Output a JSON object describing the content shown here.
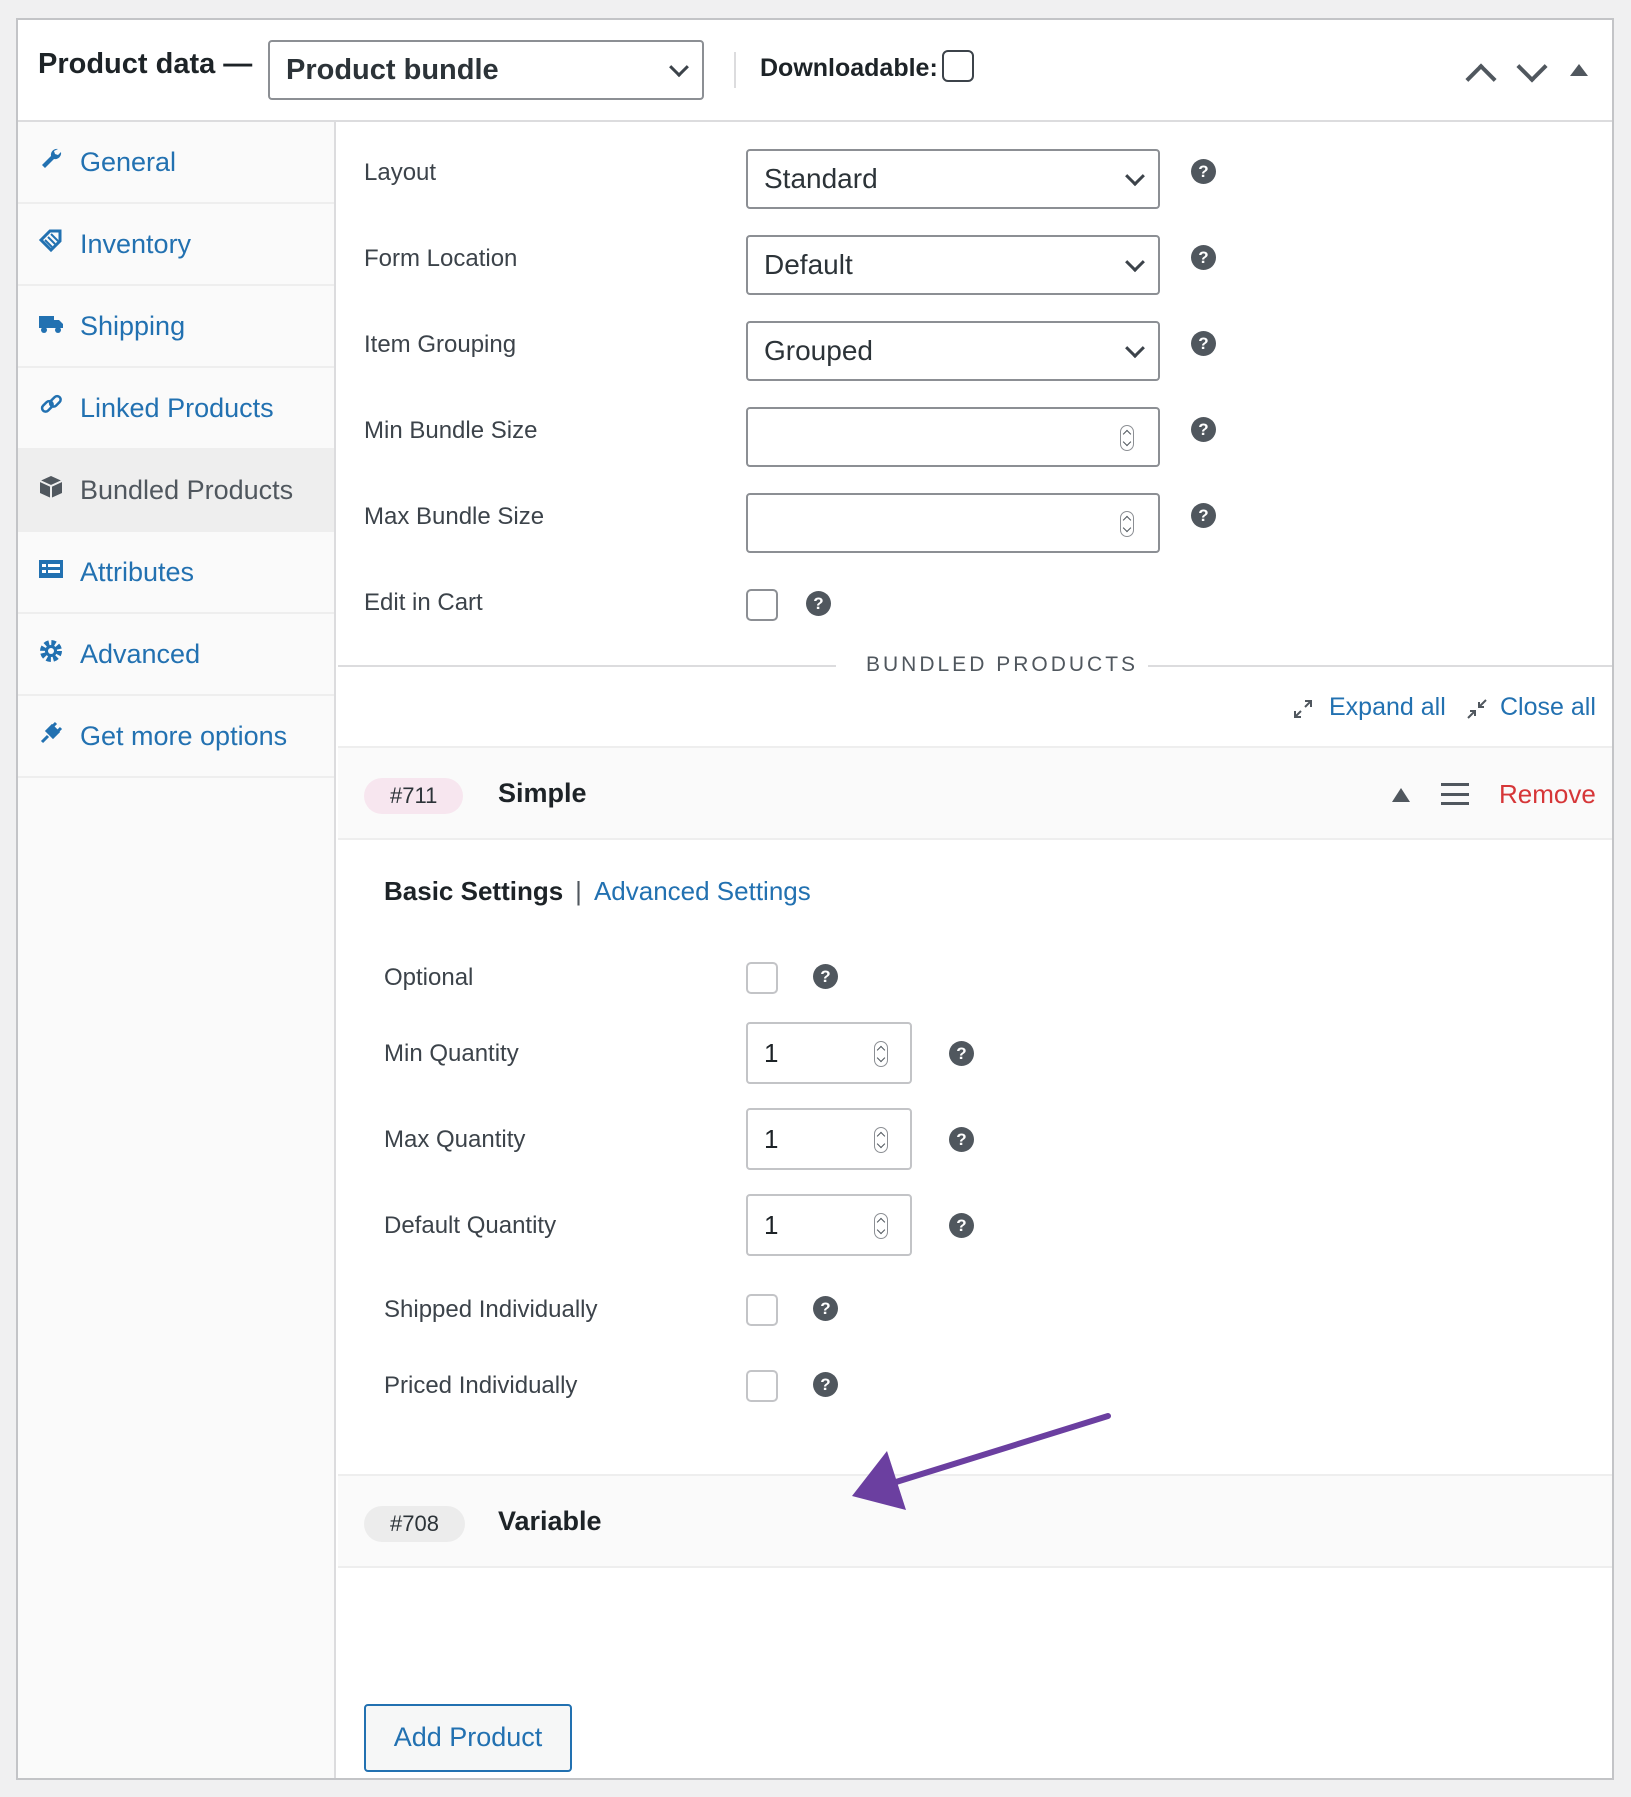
{
  "header": {
    "title": "Product data —",
    "product_type": "Product bundle",
    "downloadable_label": "Downloadable:",
    "downloadable_checked": false
  },
  "sidebar": {
    "items": [
      {
        "label": "General",
        "icon": "wrench-icon"
      },
      {
        "label": "Inventory",
        "icon": "tag-icon"
      },
      {
        "label": "Shipping",
        "icon": "truck-icon"
      },
      {
        "label": "Linked Products",
        "icon": "link-icon"
      },
      {
        "label": "Bundled Products",
        "icon": "box-icon",
        "active": true
      },
      {
        "label": "Attributes",
        "icon": "list-icon"
      },
      {
        "label": "Advanced",
        "icon": "gear-icon"
      },
      {
        "label": "Get more options",
        "icon": "plugin-icon"
      }
    ]
  },
  "settings": {
    "layout": {
      "label": "Layout",
      "value": "Standard"
    },
    "form_location": {
      "label": "Form Location",
      "value": "Default"
    },
    "item_grouping": {
      "label": "Item Grouping",
      "value": "Grouped"
    },
    "min_bundle_size": {
      "label": "Min Bundle Size",
      "value": ""
    },
    "max_bundle_size": {
      "label": "Max Bundle Size",
      "value": ""
    },
    "edit_in_cart": {
      "label": "Edit in Cart",
      "checked": false
    }
  },
  "bundled": {
    "section_title": "BUNDLED PRODUCTS",
    "expand_all": "Expand all",
    "close_all": "Close all",
    "items": [
      {
        "id": "#711",
        "name": "Simple",
        "pill_color": "#f7e6ef",
        "remove": "Remove"
      },
      {
        "id": "#708",
        "name": "Variable",
        "pill_color": "#ececec"
      }
    ],
    "tabs": {
      "basic": "Basic Settings",
      "separator": "|",
      "advanced": "Advanced Settings"
    },
    "fields": {
      "optional": {
        "label": "Optional",
        "checked": false
      },
      "min_quantity": {
        "label": "Min Quantity",
        "value": "1"
      },
      "max_quantity": {
        "label": "Max Quantity",
        "value": "1"
      },
      "default_quantity": {
        "label": "Default Quantity",
        "value": "1"
      },
      "shipped_individually": {
        "label": "Shipped Individually",
        "checked": false
      },
      "priced_individually": {
        "label": "Priced Individually",
        "checked": false
      }
    },
    "add_product": "Add Product"
  },
  "help_glyph": "?",
  "colors": {
    "link": "#2271b1",
    "remove": "#d63638",
    "annotation_arrow": "#6b3fa0"
  }
}
